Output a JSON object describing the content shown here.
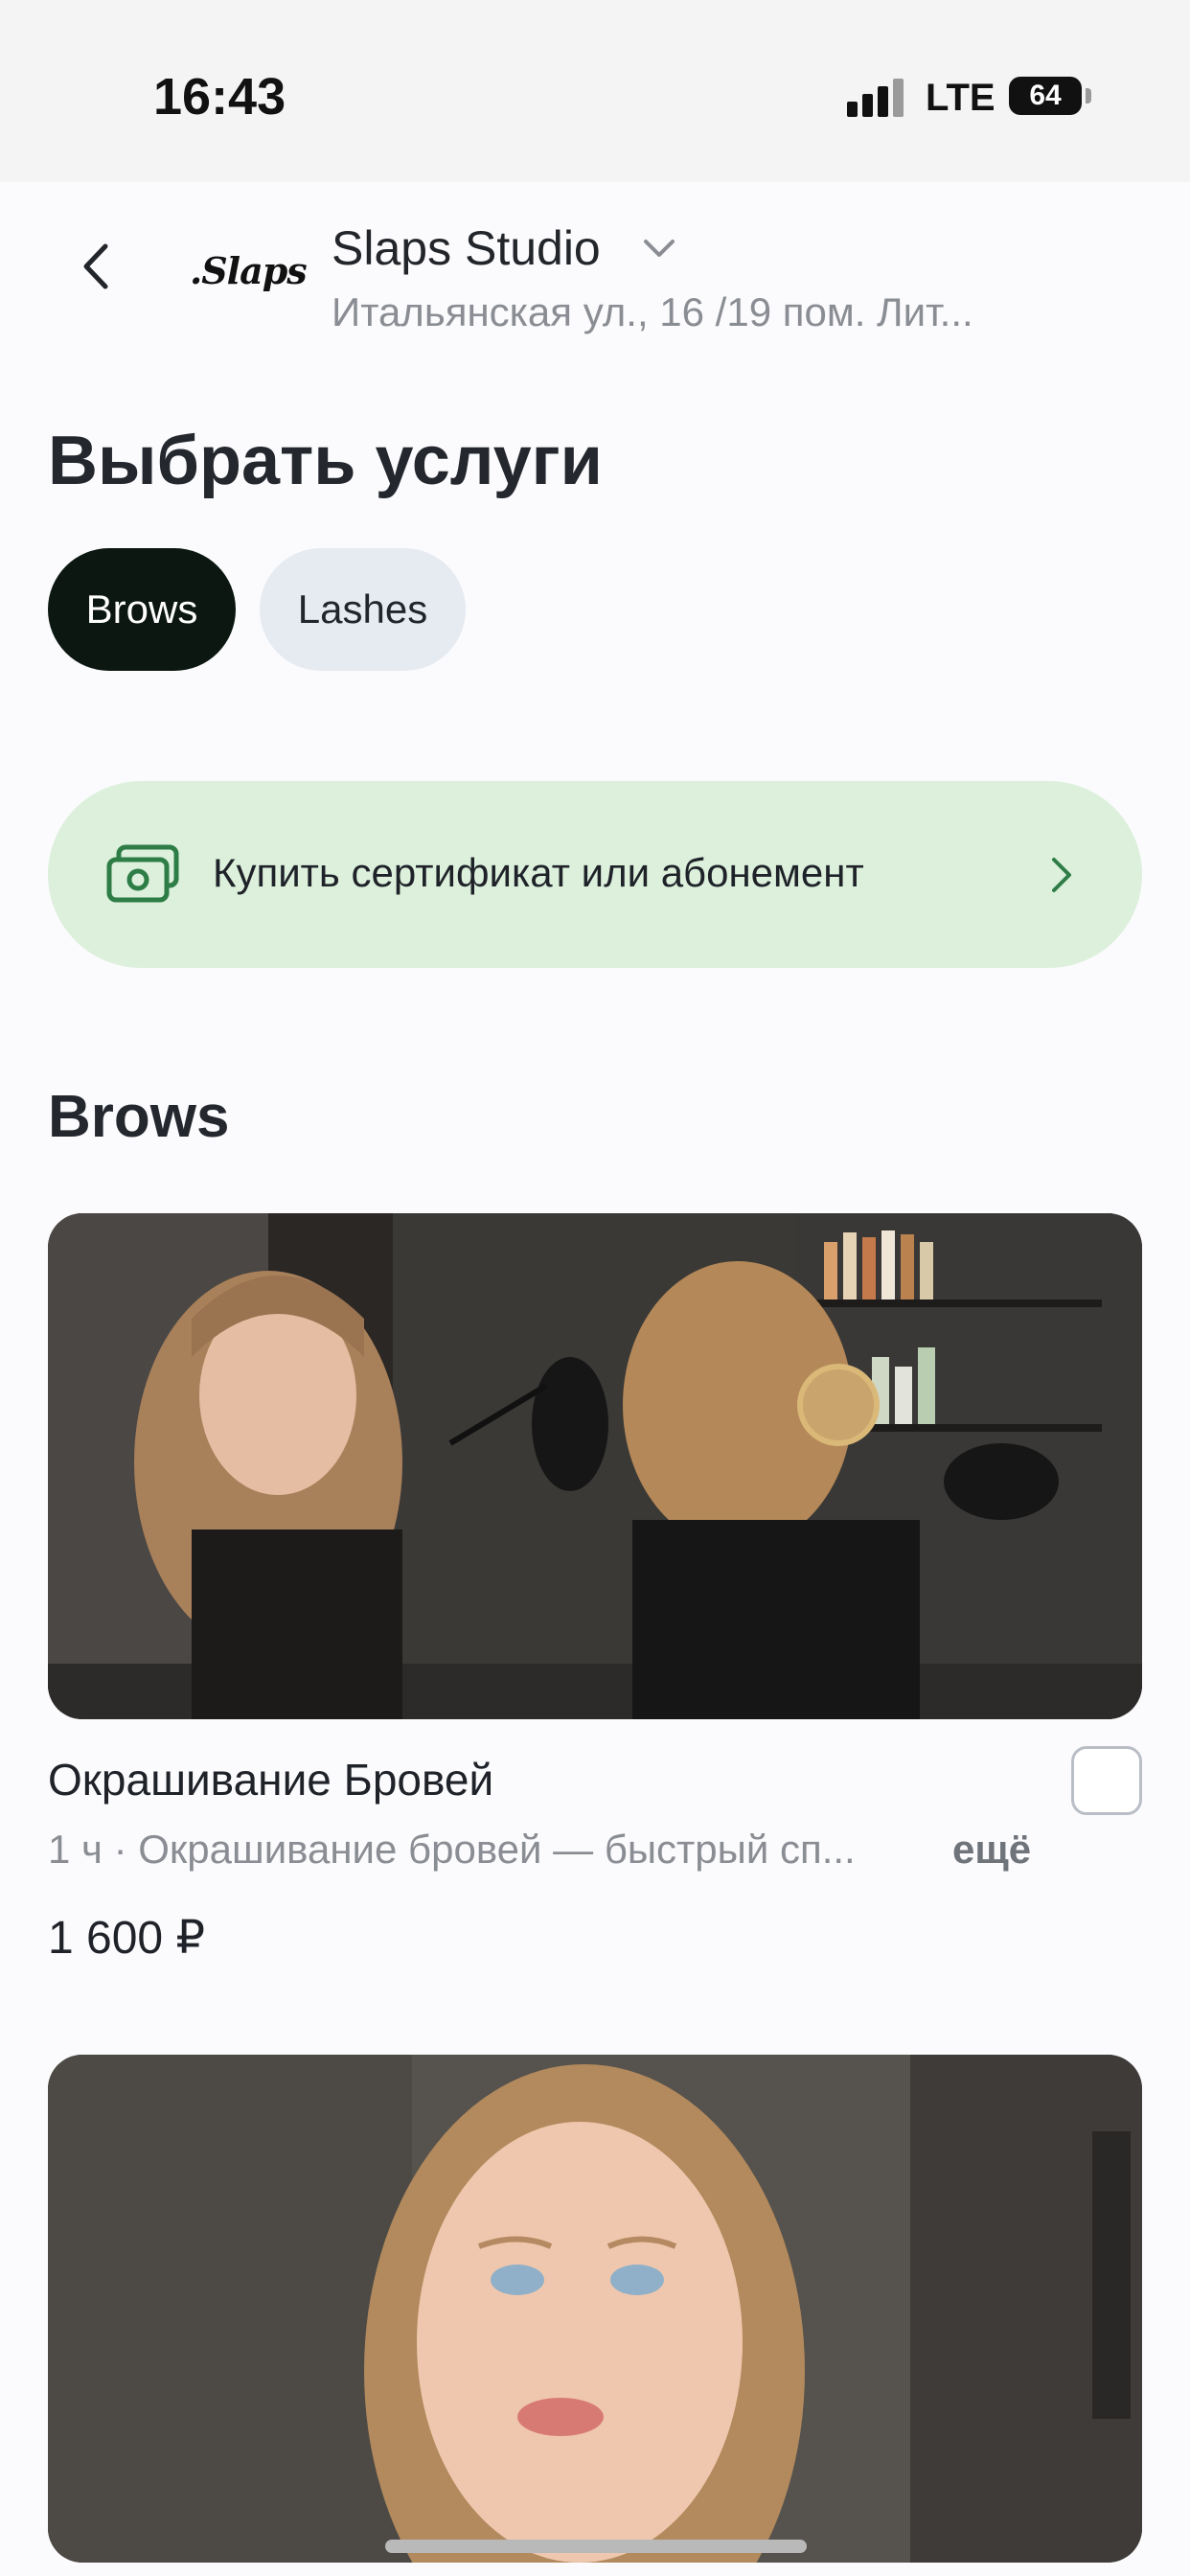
{
  "status_bar": {
    "time": "16:43",
    "network": "LTE",
    "battery": "64",
    "signal_bars": 3
  },
  "header": {
    "logo_text": ".Slaps",
    "studio_name": "Slaps Studio",
    "address": "Итальянская ул., 16 /19 пом. Лит..."
  },
  "page": {
    "title": "Выбрать услуги"
  },
  "tabs": [
    {
      "label": "Brows",
      "active": true
    },
    {
      "label": "Lashes",
      "active": false
    }
  ],
  "certificate_banner": {
    "label": "Купить сертификат или абонемент",
    "background": "#dcf0dc",
    "icon_color": "#2e7d46"
  },
  "section": {
    "title": "Brows"
  },
  "services": [
    {
      "name": "Окрашивание Бровей",
      "duration": "1 ч",
      "description": "Окрашивание бровей — быстрый сп...",
      "more_label": "ещё",
      "price": "1 600 ₽",
      "selected": false
    }
  ],
  "colors": {
    "active_tab": "#0b1710",
    "inactive_tab": "#e6ebf2",
    "secondary_text": "#8a8d93"
  }
}
